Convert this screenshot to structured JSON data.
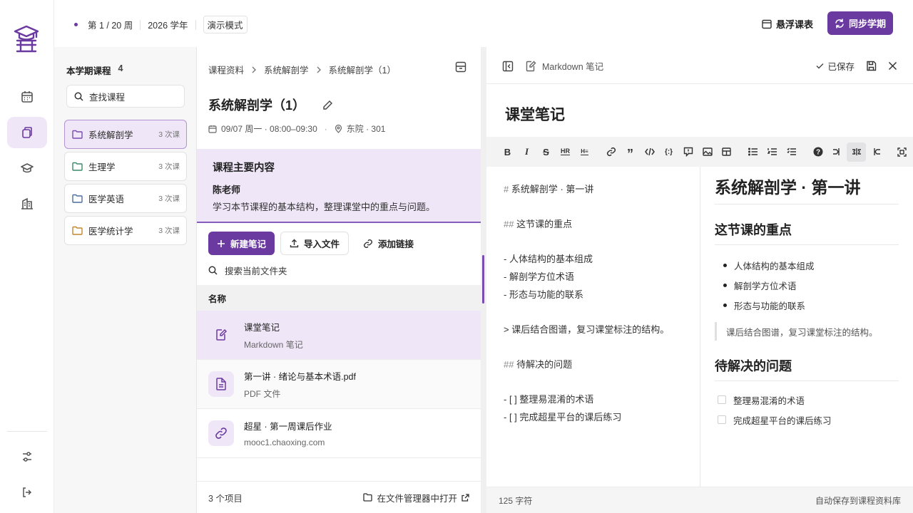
{
  "topbar": {
    "week": "第 1 / 20 周",
    "year": "2026 学年",
    "mode": "演示模式",
    "float_label": "悬浮课表",
    "sync_label": "同步学期"
  },
  "courses_panel": {
    "title": "本学期课程",
    "count": "4",
    "search_placeholder": "查找课程",
    "items": [
      {
        "name": "系统解剖学",
        "sessions": "3 次课",
        "color": "#7a4bb0"
      },
      {
        "name": "生理学",
        "sessions": "3 次课",
        "color": "#3a8a6a"
      },
      {
        "name": "医学英语",
        "sessions": "3 次课",
        "color": "#4a6fa0"
      },
      {
        "name": "医学统计学",
        "sessions": "3 次课",
        "color": "#c4862a"
      }
    ]
  },
  "files_panel": {
    "breadcrumb": [
      "课程资料",
      "系统解剖学",
      "系统解剖学（1）"
    ],
    "title": "系统解剖学（1）",
    "date": "09/07 周一 · 08:00–09:30",
    "location": "东院 · 301",
    "summary_heading": "课程主要内容",
    "teacher": "陈老师",
    "summary_text": "学习本节课程的基本结构，整理课堂中的重点与问题。",
    "new_note": "新建笔记",
    "import_file": "导入文件",
    "add_link": "添加链接",
    "search_placeholder": "搜索当前文件夹",
    "column_name": "名称",
    "files": [
      {
        "name": "课堂笔记",
        "type": "Markdown 笔记",
        "icon": "note-edit-icon"
      },
      {
        "name": "第一讲 · 绪论与基本术语.pdf",
        "type": "PDF 文件",
        "icon": "document-icon"
      },
      {
        "name": "超星 · 第一周课后作业",
        "type": "mooc1.chaoxing.com",
        "icon": "link-icon"
      }
    ],
    "item_count": "3 个项目",
    "open_in_manager": "在文件管理器中打开"
  },
  "editor": {
    "doc_type": "Markdown 笔记",
    "saved": "已保存",
    "title": "课堂笔记",
    "source_lines": [
      "# 系统解剖学 · 第一讲",
      "",
      "## 这节课的重点",
      "",
      "- 人体结构的基本组成",
      "- 解剖学方位术语",
      "- 形态与功能的联系",
      "",
      "> 课后结合图谱，复习课堂标注的结构。",
      "",
      "## 待解决的问题",
      "",
      "- [ ] 整理易混淆的术语",
      "- [ ] 完成超星平台的课后练习"
    ],
    "preview": {
      "h1": "系统解剖学 · 第一讲",
      "h2a": "这节课的重点",
      "bullets": [
        "人体结构的基本组成",
        "解剖学方位术语",
        "形态与功能的联系"
      ],
      "quote": "课后结合图谱，复习课堂标注的结构。",
      "h2b": "待解决的问题",
      "tasks": [
        "整理易混淆的术语",
        "完成超星平台的课后练习"
      ]
    },
    "char_count": "125 字符",
    "autosave": "自动保存到课程资料库"
  },
  "colors": {
    "accent": "#6b3aa0",
    "accent_light": "#efe6f7"
  }
}
